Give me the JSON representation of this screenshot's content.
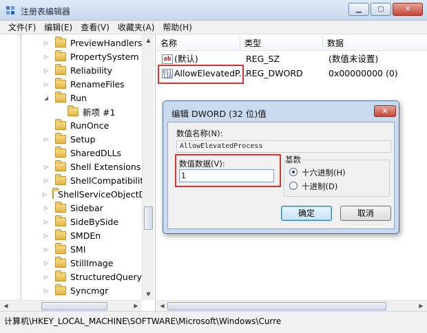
{
  "window": {
    "title": "注册表编辑器",
    "icon": "regedit-icon"
  },
  "menu": [
    "文件(F)",
    "编辑(E)",
    "查看(V)",
    "收藏夹(A)",
    "帮助(H)"
  ],
  "tree": {
    "items": [
      {
        "label": "PreviewHandlers",
        "expander": "▷"
      },
      {
        "label": "PropertySystem",
        "expander": "▷"
      },
      {
        "label": "Reliability",
        "expander": "▷"
      },
      {
        "label": "RenameFiles",
        "expander": "▷"
      },
      {
        "label": "Run",
        "expander": "◢"
      },
      {
        "label": "新项 #1",
        "expander": ""
      },
      {
        "label": "RunOnce",
        "expander": ""
      },
      {
        "label": "Setup",
        "expander": "▷"
      },
      {
        "label": "SharedDLLs",
        "expander": ""
      },
      {
        "label": "Shell Extensions",
        "expander": "▷"
      },
      {
        "label": "ShellCompatibility",
        "expander": "▷"
      },
      {
        "label": "ShellServiceObjectD",
        "expander": "▷"
      },
      {
        "label": "Sidebar",
        "expander": "▷"
      },
      {
        "label": "SideBySide",
        "expander": "▷"
      },
      {
        "label": "SMDEn",
        "expander": "▷"
      },
      {
        "label": "SMI",
        "expander": "▷"
      },
      {
        "label": "StillImage",
        "expander": "▷"
      },
      {
        "label": "StructuredQuery",
        "expander": "▷"
      },
      {
        "label": "Syncmgr",
        "expander": "▷"
      }
    ]
  },
  "columns": {
    "name": "名称",
    "type": "类型",
    "data": "数据"
  },
  "values": [
    {
      "name": "(默认)",
      "type": "REG_SZ",
      "data": "(数值未设置)",
      "icon": "ab"
    },
    {
      "name": "AllowElevatedP...",
      "type": "REG_DWORD",
      "data": "0x00000000 (0)",
      "icon": "011"
    }
  ],
  "status": {
    "path": "计算机\\HKEY_LOCAL_MACHINE\\SOFTWARE\\Microsoft\\Windows\\Curre"
  },
  "dialog": {
    "title": "编辑 DWORD (32 位)值",
    "value_name_label": "数值名称(N):",
    "value_name": "AllowElevatedProcess",
    "value_data_label": "数值数据(V):",
    "value_data": "1",
    "base_label": "基数",
    "hex_label": "十六进制(H)",
    "dec_label": "十进制(D)",
    "hex_selected": true,
    "ok_label": "确定",
    "cancel_label": "取消"
  },
  "colors": {
    "highlight_box": "#d9302a",
    "dialog_frame": "#c9daee"
  }
}
